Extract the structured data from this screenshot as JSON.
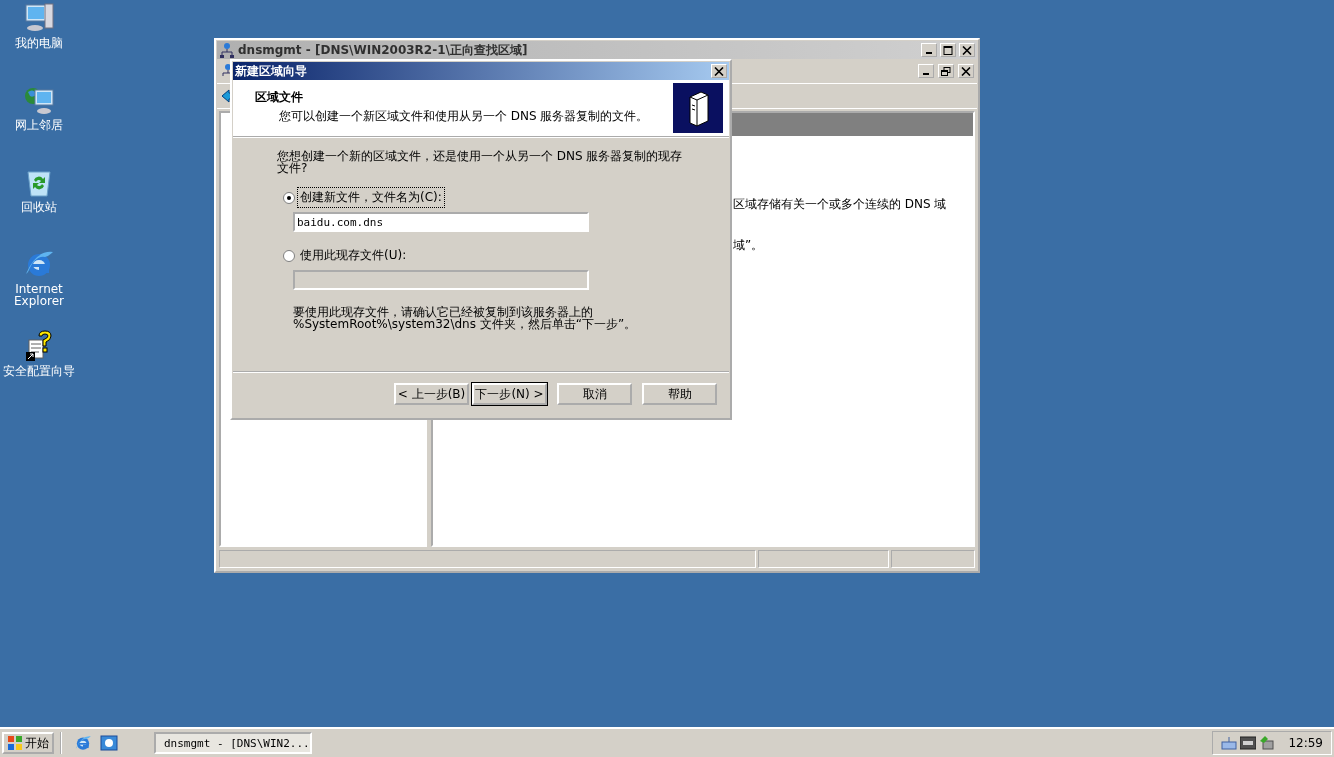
{
  "desktop_icons": [
    {
      "kind": "computer",
      "label": "我的电脑"
    },
    {
      "kind": "network",
      "label": "网上邻居"
    },
    {
      "kind": "recycle",
      "label": "回收站"
    },
    {
      "kind": "ie",
      "label": "Internet Explorer"
    },
    {
      "kind": "wizard",
      "label": "安全配置向导"
    }
  ],
  "background_window": {
    "title": "dnsmgmt - [DNS\\WIN2003R2-1\\正向查找区域]",
    "active": false,
    "right_pane": {
      "lines": [
        "区域存储有关一个或多个连续的 DNS 域",
        "域”。"
      ]
    }
  },
  "dialog": {
    "title": "新建区域向导",
    "header": {
      "title": "区域文件",
      "subtitle": "您可以创建一个新区域文件和使用从另一个 DNS 服务器复制的文件。"
    },
    "question": [
      "您想创建一个新的区域文件，还是使用一个从另一个 DNS 服务器复制的现存",
      "文件?"
    ],
    "options": [
      {
        "label": "创建新文件，文件名为(C):",
        "selected": true,
        "field": {
          "value": "baidu.com.dns",
          "disabled": false
        }
      },
      {
        "label": "使用此现存文件(U):",
        "selected": false,
        "field": {
          "disabled": true
        }
      }
    ],
    "note": [
      "要使用此现存文件，请确认它已经被复制到该服务器上的",
      "%SystemRoot%\\system32\\dns 文件夹，然后单击“下一步”。"
    ],
    "buttons": [
      {
        "label": "< 上一步(B)",
        "default": false
      },
      {
        "label": "下一步(N) >",
        "default": true
      },
      {
        "label": "取消",
        "default": false
      },
      {
        "label": "帮助",
        "default": false
      }
    ]
  },
  "taskbar": {
    "start_label": "开始",
    "tasks": [
      {
        "label": "dnsmgmt - [DNS\\WIN2...",
        "active": true
      }
    ],
    "clock": "12:59"
  }
}
